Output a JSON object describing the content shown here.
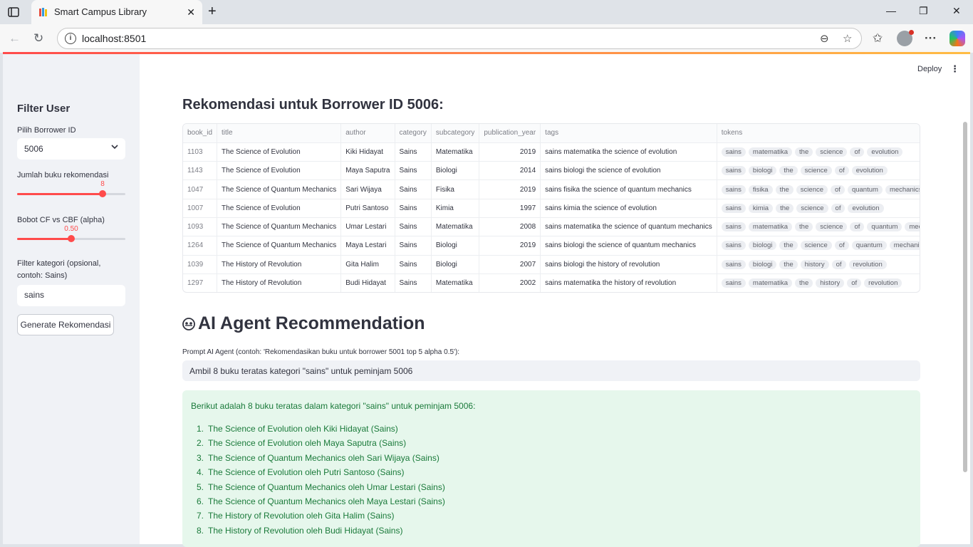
{
  "browser": {
    "tab_title": "Smart Campus Library",
    "url": "localhost:8501"
  },
  "toolbar": {
    "deploy_label": "Deploy"
  },
  "sidebar": {
    "title": "Filter User",
    "borrower_label": "Pilih Borrower ID",
    "borrower_value": "5006",
    "count_label": "Jumlah buku rekomendasi",
    "count_value": "8",
    "count_fraction": 0.79,
    "alpha_label": "Bobot CF vs CBF (alpha)",
    "alpha_value": "0.50",
    "alpha_fraction": 0.5,
    "category_label": "Filter kategori (opsional, contoh: Sains)",
    "category_value": "sains",
    "generate_button": "Generate Rekomendasi"
  },
  "main": {
    "rec_heading": "Rekomendasi untuk Borrower ID 5006:",
    "table": {
      "columns": [
        "book_id",
        "title",
        "author",
        "category",
        "subcategory",
        "publication_year",
        "tags",
        "tokens"
      ],
      "rows": [
        {
          "book_id": "1103",
          "title": "The Science of Evolution",
          "author": "Kiki Hidayat",
          "category": "Sains",
          "subcategory": "Matematika",
          "publication_year": "2019",
          "tags": "sains matematika the science of evolution",
          "tokens": [
            "sains",
            "matematika",
            "the",
            "science",
            "of",
            "evolution"
          ]
        },
        {
          "book_id": "1143",
          "title": "The Science of Evolution",
          "author": "Maya Saputra",
          "category": "Sains",
          "subcategory": "Biologi",
          "publication_year": "2014",
          "tags": "sains biologi the science of evolution",
          "tokens": [
            "sains",
            "biologi",
            "the",
            "science",
            "of",
            "evolution"
          ]
        },
        {
          "book_id": "1047",
          "title": "The Science of Quantum Mechanics",
          "author": "Sari Wijaya",
          "category": "Sains",
          "subcategory": "Fisika",
          "publication_year": "2019",
          "tags": "sains fisika the science of quantum mechanics",
          "tokens": [
            "sains",
            "fisika",
            "the",
            "science",
            "of",
            "quantum",
            "mechanics"
          ]
        },
        {
          "book_id": "1007",
          "title": "The Science of Evolution",
          "author": "Putri Santoso",
          "category": "Sains",
          "subcategory": "Kimia",
          "publication_year": "1997",
          "tags": "sains kimia the science of evolution",
          "tokens": [
            "sains",
            "kimia",
            "the",
            "science",
            "of",
            "evolution"
          ]
        },
        {
          "book_id": "1093",
          "title": "The Science of Quantum Mechanics",
          "author": "Umar Lestari",
          "category": "Sains",
          "subcategory": "Matematika",
          "publication_year": "2008",
          "tags": "sains matematika the science of quantum mechanics",
          "tokens": [
            "sains",
            "matematika",
            "the",
            "science",
            "of",
            "quantum",
            "mec"
          ]
        },
        {
          "book_id": "1264",
          "title": "The Science of Quantum Mechanics",
          "author": "Maya Lestari",
          "category": "Sains",
          "subcategory": "Biologi",
          "publication_year": "2019",
          "tags": "sains biologi the science of quantum mechanics",
          "tokens": [
            "sains",
            "biologi",
            "the",
            "science",
            "of",
            "quantum",
            "mechani"
          ]
        },
        {
          "book_id": "1039",
          "title": "The History of Revolution",
          "author": "Gita Halim",
          "category": "Sains",
          "subcategory": "Biologi",
          "publication_year": "2007",
          "tags": "sains biologi the history of revolution",
          "tokens": [
            "sains",
            "biologi",
            "the",
            "history",
            "of",
            "revolution"
          ]
        },
        {
          "book_id": "1297",
          "title": "The History of Revolution",
          "author": "Budi Hidayat",
          "category": "Sains",
          "subcategory": "Matematika",
          "publication_year": "2002",
          "tags": "sains matematika the history of revolution",
          "tokens": [
            "sains",
            "matematika",
            "the",
            "history",
            "of",
            "revolution"
          ]
        }
      ]
    },
    "ai_heading": "AI Agent Recommendation",
    "prompt_label": "Prompt AI Agent (contoh: 'Rekomendasikan buku untuk borrower 5001 top 5 alpha 0.5'):",
    "prompt_value": "Ambil 8 buku teratas kategori \"sains\" untuk peminjam 5006",
    "answer_intro": "Berikut adalah 8 buku teratas dalam kategori \"sains\" untuk peminjam 5006:",
    "answer_items": [
      "The Science of Evolution oleh Kiki Hidayat (Sains)",
      "The Science of Evolution oleh Maya Saputra (Sains)",
      "The Science of Quantum Mechanics oleh Sari Wijaya (Sains)",
      "The Science of Evolution oleh Putri Santoso (Sains)",
      "The Science of Quantum Mechanics oleh Umar Lestari (Sains)",
      "The Science of Quantum Mechanics oleh Maya Lestari (Sains)",
      "The History of Revolution oleh Gita Halim (Sains)",
      "The History of Revolution oleh Budi Hidayat (Sains)"
    ]
  },
  "colors": {
    "accent": "#ff4b4b",
    "success_bg": "#e6f7ec",
    "success_text": "#1a7a3a"
  }
}
